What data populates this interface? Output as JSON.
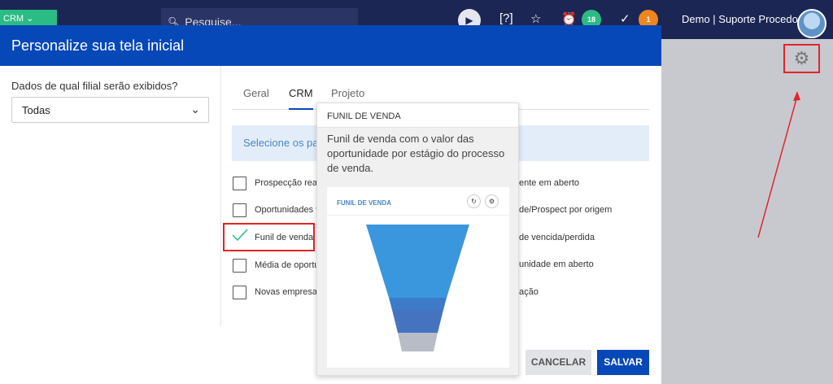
{
  "topbar": {
    "crm_label": "CRM",
    "search_placeholder": "Pesquise...",
    "notifications_count": "18",
    "tasks_count": "1",
    "user_name": "Demo | Suporte Procedo"
  },
  "modal": {
    "title": "Personalize sua tela inicial",
    "branch_question": "Dados de qual filial serão exibidos?",
    "branch_value": "Todas",
    "tabs": [
      {
        "label": "Geral"
      },
      {
        "label": "CRM"
      },
      {
        "label": "Projeto"
      }
    ],
    "info_text": "Selecione os pai",
    "left_items": [
      {
        "label": "Prospecção reali",
        "checked": false
      },
      {
        "label": "Oportunidades v",
        "checked": false
      },
      {
        "label": "Funil de venda",
        "checked": true
      },
      {
        "label": "Média de oportu",
        "checked": false
      },
      {
        "label": "Novas empresas",
        "checked": false
      }
    ],
    "right_items": [
      {
        "label": "ente em aberto"
      },
      {
        "label": "de/Prospect por origem"
      },
      {
        "label": "de vencida/perdida"
      },
      {
        "label": "unidade em aberto"
      },
      {
        "label": "ação"
      }
    ],
    "cancel_label": "CANCELAR",
    "save_label": "SALVAR"
  },
  "popover": {
    "title": "FUNIL DE VENDA",
    "description": "Funil de venda com o valor das oportunidade por estágio do processo de venda.",
    "preview_title": "FUNIL DE VENDA"
  },
  "colors": {
    "header_blue": "#0748b8",
    "topbar_navy": "#1b2654",
    "accent_green": "#2bbb85",
    "badge_orange": "#f0871e",
    "annotation_red": "#e3242b"
  }
}
